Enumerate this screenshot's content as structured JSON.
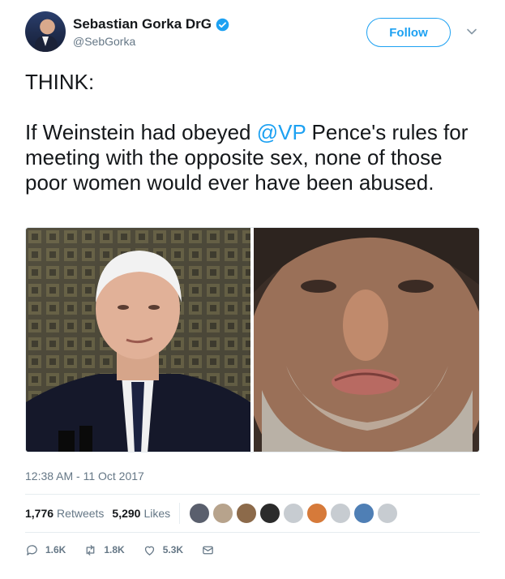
{
  "author": {
    "display_name": "Sebastian Gorka DrG",
    "handle": "@SebGorka",
    "verified": true
  },
  "follow_label": "Follow",
  "tweet": {
    "line1": "THINK:",
    "body_before": "If Weinstein had obeyed ",
    "mention": "@VP",
    "body_after": " Pence's rules for meeting with the opposite sex, none of those poor women would ever have been abused."
  },
  "timestamp": "12:38 AM - 11 Oct 2017",
  "stats": {
    "retweets_count": "1,776",
    "retweets_label": "Retweets",
    "likes_count": "5,290",
    "likes_label": "Likes"
  },
  "likers": [
    "#5a5f6d",
    "#b7a38c",
    "#8c6a4a",
    "#2b2b2b",
    "#c7ccd1",
    "#d67a3a",
    "#c7ccd1",
    "#4f7fb5",
    "#c7ccd1"
  ],
  "actions": {
    "replies": "1.6K",
    "retweets": "1.8K",
    "likes": "5.3K"
  },
  "colors": {
    "accent": "#1da1f2",
    "muted": "#657786",
    "text": "#14171a",
    "border": "#e6ecf0"
  }
}
